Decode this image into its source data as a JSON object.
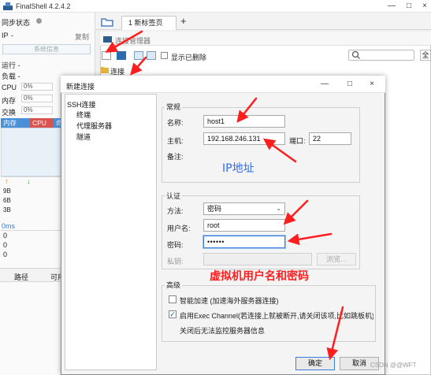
{
  "app": {
    "title": "FinalShell 4.2.4.2"
  },
  "left_panel": {
    "sync_status": "同步状态",
    "copy": "复制",
    "ip_label": "IP",
    "ip_value": "-",
    "sysinfo_button": "系统信息",
    "run_label": "运行 -",
    "load_label": "负载 -",
    "cpu_label": "CPU",
    "cpu_value": "0%",
    "mem_label": "内存",
    "mem_value": "0%",
    "swap_label": "交换",
    "swap_value": "0%",
    "proc_headers": [
      "内存",
      "CPU",
      "命"
    ],
    "net_up": "↑",
    "net_down": "↓",
    "net_values": [
      "9B",
      "6B",
      "3B"
    ],
    "latency": "0ms",
    "latency_values": [
      "0",
      "0",
      "0"
    ],
    "bottom_tabs": [
      "路径",
      "可用"
    ]
  },
  "tabs": {
    "new_tab": "1 新标签页",
    "add_tab": "+"
  },
  "conn_manager": {
    "title": "连接管理器",
    "show_deleted": "显示已删除",
    "tree_root": "连接",
    "right_button": "全"
  },
  "dialog": {
    "title": "新建连接",
    "tree": [
      "SSH连接",
      "终端",
      "代理服务器",
      "隧道"
    ],
    "general": {
      "title": "常规",
      "name_label": "名称:",
      "name_value": "host1",
      "host_label": "主机:",
      "host_value": "192.168.246.131",
      "port_label": "端口:",
      "port_value": "22",
      "remark_label": "备注:"
    },
    "auth": {
      "title": "认证",
      "method_label": "方法:",
      "method_value": "密码",
      "user_label": "用户名:",
      "user_value": "root",
      "pass_label": "密码:",
      "pass_value": "••••••",
      "key_label": "私钥:",
      "browse_button": "浏览..."
    },
    "advanced": {
      "title": "高级",
      "accel_label": "智能加速 (加速海外服务器连接)",
      "accel_checked": false,
      "exec_label": "启用Exec Channel(若连接上就被断开,请关闭该项,比如跳板机)",
      "exec_checked": true,
      "exec_note": "关闭后无法监控服务器信息"
    },
    "ok_button": "确定",
    "cancel_button": "取消"
  },
  "annotations": {
    "ip_note": "IP地址",
    "cred_note": "虚拟机用户名和密码",
    "watermark": "CSDN @@WFT"
  },
  "colors": {
    "accent": "#2d6cf0",
    "annotation_red": "#ff1e1e",
    "proc_head_blue": "#4a90d9",
    "proc_head_red": "#d9534f"
  }
}
